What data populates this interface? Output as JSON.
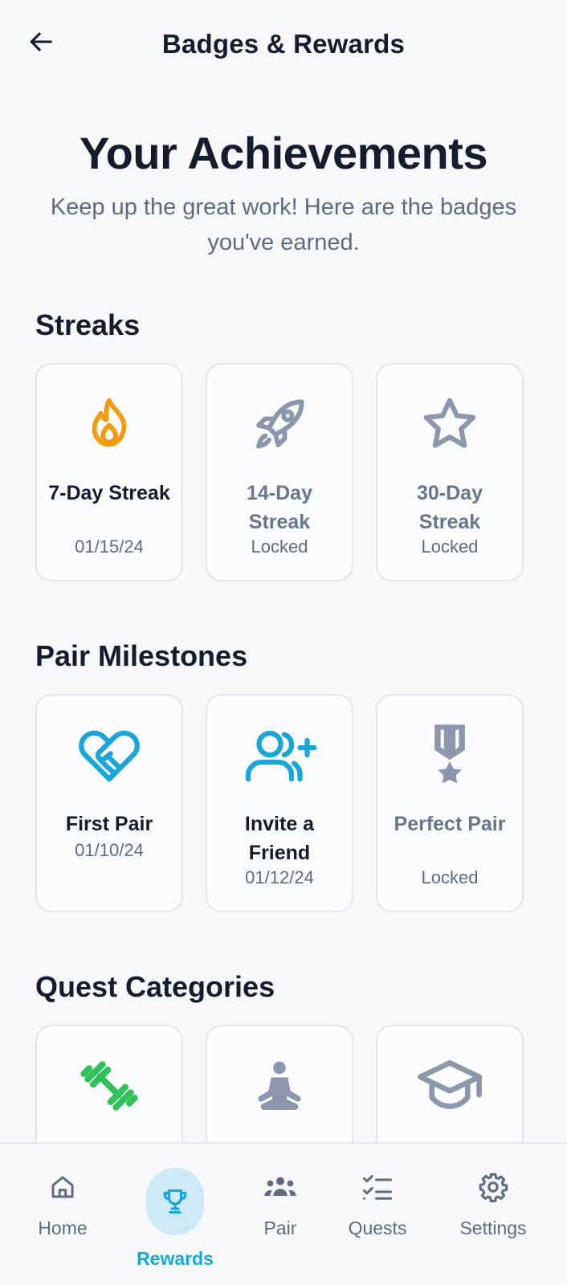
{
  "header": {
    "title": "Badges & Rewards"
  },
  "hero": {
    "title": "Your Achievements",
    "subtitle": "Keep up the great work! Here are the badges you've earned."
  },
  "sections": [
    {
      "title": "Streaks",
      "badges": [
        {
          "name": "7-Day Streak",
          "meta": "01/15/24",
          "icon": "flame-icon",
          "color": "#f29a12",
          "locked": false
        },
        {
          "name": "14-Day Streak",
          "meta": "Locked",
          "icon": "rocket-icon",
          "color": "#8c97ad",
          "locked": true
        },
        {
          "name": "30-Day Streak",
          "meta": "Locked",
          "icon": "star-icon",
          "color": "#8c97ad",
          "locked": true
        }
      ]
    },
    {
      "title": "Pair Milestones",
      "badges": [
        {
          "name": "First Pair",
          "meta": "01/10/24",
          "icon": "handshake-icon",
          "color": "#1aa7d8",
          "locked": false
        },
        {
          "name": "Invite a Friend",
          "meta": "01/12/24",
          "icon": "user-plus-icon",
          "color": "#1aa7d8",
          "locked": false
        },
        {
          "name": "Perfect Pair",
          "meta": "Locked",
          "icon": "medal-icon",
          "color": "#8c97ad",
          "locked": true
        }
      ]
    },
    {
      "title": "Quest Categories",
      "badges": [
        {
          "icon": "dumbbell-icon",
          "color": "#2fc25b"
        },
        {
          "icon": "meditation-icon",
          "color": "#8c97ad"
        },
        {
          "icon": "graduation-cap-icon",
          "color": "#8c97ad"
        }
      ]
    }
  ],
  "nav": {
    "items": [
      {
        "label": "Home",
        "icon": "home-icon",
        "active": false
      },
      {
        "label": "Rewards",
        "icon": "trophy-icon",
        "active": true
      },
      {
        "label": "Pair",
        "icon": "group-icon",
        "active": false
      },
      {
        "label": "Quests",
        "icon": "checklist-icon",
        "active": false
      },
      {
        "label": "Settings",
        "icon": "gear-icon",
        "active": false
      }
    ]
  },
  "colors": {
    "accent": "#1aa7d8",
    "accent_soft": "#cdeaf6",
    "text": "#141c2e",
    "muted": "#5f6b7e"
  }
}
